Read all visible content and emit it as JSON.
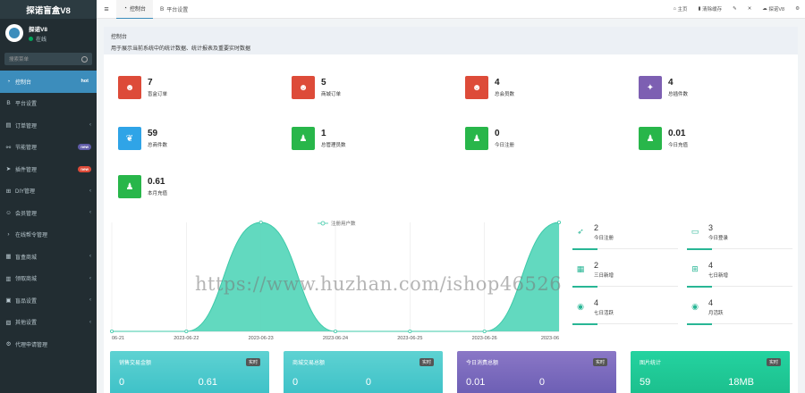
{
  "app": {
    "title": "探诺盲盒V8"
  },
  "user": {
    "name": "探诺V8",
    "status": "在线"
  },
  "search": {
    "placeholder": "搜索菜单"
  },
  "sidebar": {
    "items": [
      {
        "label": "控制台",
        "icon": "dashboard-icon",
        "badge": "hot"
      },
      {
        "label": "平台设置",
        "icon": "b-icon"
      },
      {
        "label": "订单管理",
        "icon": "list-icon"
      },
      {
        "label": "节能管理",
        "icon": "share-icon",
        "badge": "new"
      },
      {
        "label": "插件管理",
        "icon": "plane-icon",
        "badge": "new"
      },
      {
        "label": "DIY管理",
        "icon": "grid-icon"
      },
      {
        "label": "会员管理",
        "icon": "user-icon"
      },
      {
        "label": "在线帮令管理",
        "icon": "chevron-icon"
      },
      {
        "label": "盲盒商城",
        "icon": "box-icon"
      },
      {
        "label": "领取商城",
        "icon": "cart-icon"
      },
      {
        "label": "盲品设置",
        "icon": "gift-icon"
      },
      {
        "label": "其他设置",
        "icon": "cog-icon"
      },
      {
        "label": "代理申请管理",
        "icon": "gear-icon"
      }
    ]
  },
  "topbar": {
    "tabs": [
      {
        "label": "控制台"
      },
      {
        "label": "平台设置"
      }
    ],
    "home": "主页",
    "clear_cache": "清除缓存",
    "account": "探诺V8"
  },
  "header": {
    "title": "控制台",
    "desc": "用于展示当前系统中的统计数据、统计报表及重要实时数据"
  },
  "stats": [
    {
      "value": "7",
      "label": "盲盒订单",
      "color": "#dd4b39",
      "icon": "users-icon"
    },
    {
      "value": "5",
      "label": "商城订单",
      "color": "#dd4b39",
      "icon": "users-icon"
    },
    {
      "value": "4",
      "label": "总会员数",
      "color": "#dd4b39",
      "icon": "users-icon"
    },
    {
      "value": "4",
      "label": "总插件数",
      "color": "#7d5fb2",
      "icon": "magic-icon"
    },
    {
      "value": "59",
      "label": "总商件数",
      "color": "#2fa4e7",
      "icon": "leaf-icon"
    },
    {
      "value": "1",
      "label": "总管理员数",
      "color": "#28b64a",
      "icon": "user-icon"
    },
    {
      "value": "0",
      "label": "今日注册",
      "color": "#28b64a",
      "icon": "user-icon"
    },
    {
      "value": "0.01",
      "label": "今日充值",
      "color": "#28b64a",
      "icon": "user-icon"
    },
    {
      "value": "0.61",
      "label": "本月充值",
      "color": "#28b64a",
      "icon": "user-icon"
    }
  ],
  "small_stats": [
    {
      "value": "2",
      "label": "今日注册",
      "icon": "rocket-icon"
    },
    {
      "value": "3",
      "label": "今日登录",
      "icon": "id-card-icon"
    },
    {
      "value": "2",
      "label": "三日新增",
      "icon": "calendar-icon"
    },
    {
      "value": "4",
      "label": "七日新增",
      "icon": "calendar-plus-icon"
    },
    {
      "value": "4",
      "label": "七日活跃",
      "icon": "user-circle-icon"
    },
    {
      "value": "4",
      "label": "月活跃",
      "icon": "user-circle-icon"
    }
  ],
  "panels": [
    {
      "title": "销售交易金额",
      "tag": "实时",
      "left": "0",
      "right": "0.61"
    },
    {
      "title": "商城交易总额",
      "tag": "实时",
      "left": "0",
      "right": "0"
    },
    {
      "title": "今日消费总额",
      "tag": "实时",
      "left": "0.01",
      "right": "0"
    },
    {
      "title": "图片统计",
      "tag": "实时",
      "left": "59",
      "right": "18MB"
    }
  ],
  "watermark": "https://www.huzhan.com/ishop46526",
  "chart_data": {
    "type": "area",
    "legend": "注册用户数",
    "x": [
      "06-21",
      "2023-06-22",
      "2023-06-23",
      "2023-06-24",
      "2023-06-25",
      "2023-06-26",
      "2023-06"
    ],
    "values": [
      0,
      0,
      2,
      0,
      0,
      0,
      2
    ],
    "ylim": [
      0,
      2
    ],
    "color": "#5ad7bc"
  }
}
